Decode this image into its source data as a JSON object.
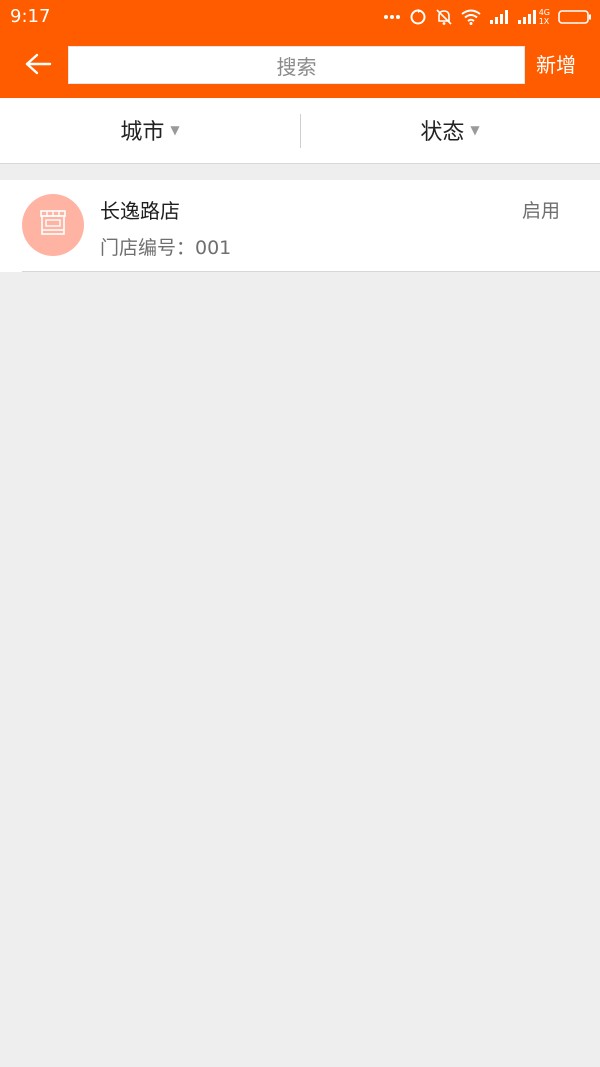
{
  "status_bar": {
    "time": "9:17",
    "network_label_top": "4G",
    "network_label_bottom": "1X",
    "icons": [
      "more-dots-icon",
      "sync-icon",
      "bell-off-icon",
      "wifi-icon",
      "signal-icon",
      "signal-4g-icon",
      "battery-icon"
    ]
  },
  "nav": {
    "back_icon": "back-arrow-icon",
    "search_placeholder": "搜索",
    "add_label": "新增"
  },
  "filters": [
    {
      "label": "城市",
      "icon": "dropdown-triangle-icon"
    },
    {
      "label": "状态",
      "icon": "dropdown-triangle-icon"
    }
  ],
  "stores": [
    {
      "name": "长逸路店",
      "code_label": "门店编号：001",
      "status": "启用",
      "icon": "store-icon"
    }
  ],
  "colors": {
    "accent": "#ff5c00",
    "avatar": "#ffb3a3",
    "background": "#eeeeee"
  }
}
